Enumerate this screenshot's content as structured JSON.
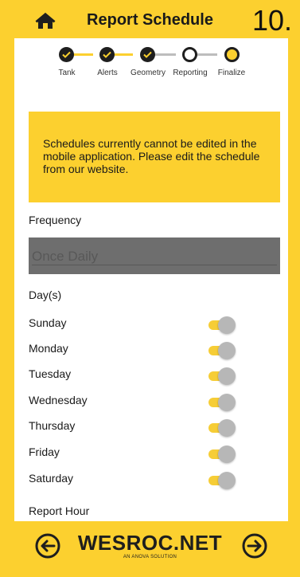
{
  "header": {
    "title": "Report Schedule",
    "step_number": "10."
  },
  "stepper": {
    "steps": [
      {
        "label": "Tank",
        "status": "done"
      },
      {
        "label": "Alerts",
        "status": "done"
      },
      {
        "label": "Geometry",
        "status": "done"
      },
      {
        "label": "Reporting",
        "status": "current"
      },
      {
        "label": "Finalize",
        "status": "todo"
      }
    ]
  },
  "notice": {
    "text": "Schedules currently cannot be edited in the mobile application. Please edit the schedule from our website."
  },
  "frequency": {
    "label": "Frequency",
    "value": "Once Daily"
  },
  "days": {
    "label": "Day(s)",
    "items": [
      {
        "label": "Sunday",
        "on": false
      },
      {
        "label": "Monday",
        "on": false
      },
      {
        "label": "Tuesday",
        "on": false
      },
      {
        "label": "Wednesday",
        "on": false
      },
      {
        "label": "Thursday",
        "on": false
      },
      {
        "label": "Friday",
        "on": false
      },
      {
        "label": "Saturday",
        "on": false
      }
    ]
  },
  "report_hour": {
    "label": "Report Hour"
  },
  "footer": {
    "brand": "WESROC.NET",
    "brand_sub": "AN ANOVA SOLUTION"
  },
  "colors": {
    "accent": "#fcd02f",
    "toggle_track": "#f6cd36",
    "toggle_knob": "#b7b7b7",
    "dark": "#1e1e1e"
  },
  "icons": {
    "home": "home-icon",
    "back": "arrow-left-circle-icon",
    "next": "arrow-right-circle-icon",
    "check": "check-icon"
  }
}
